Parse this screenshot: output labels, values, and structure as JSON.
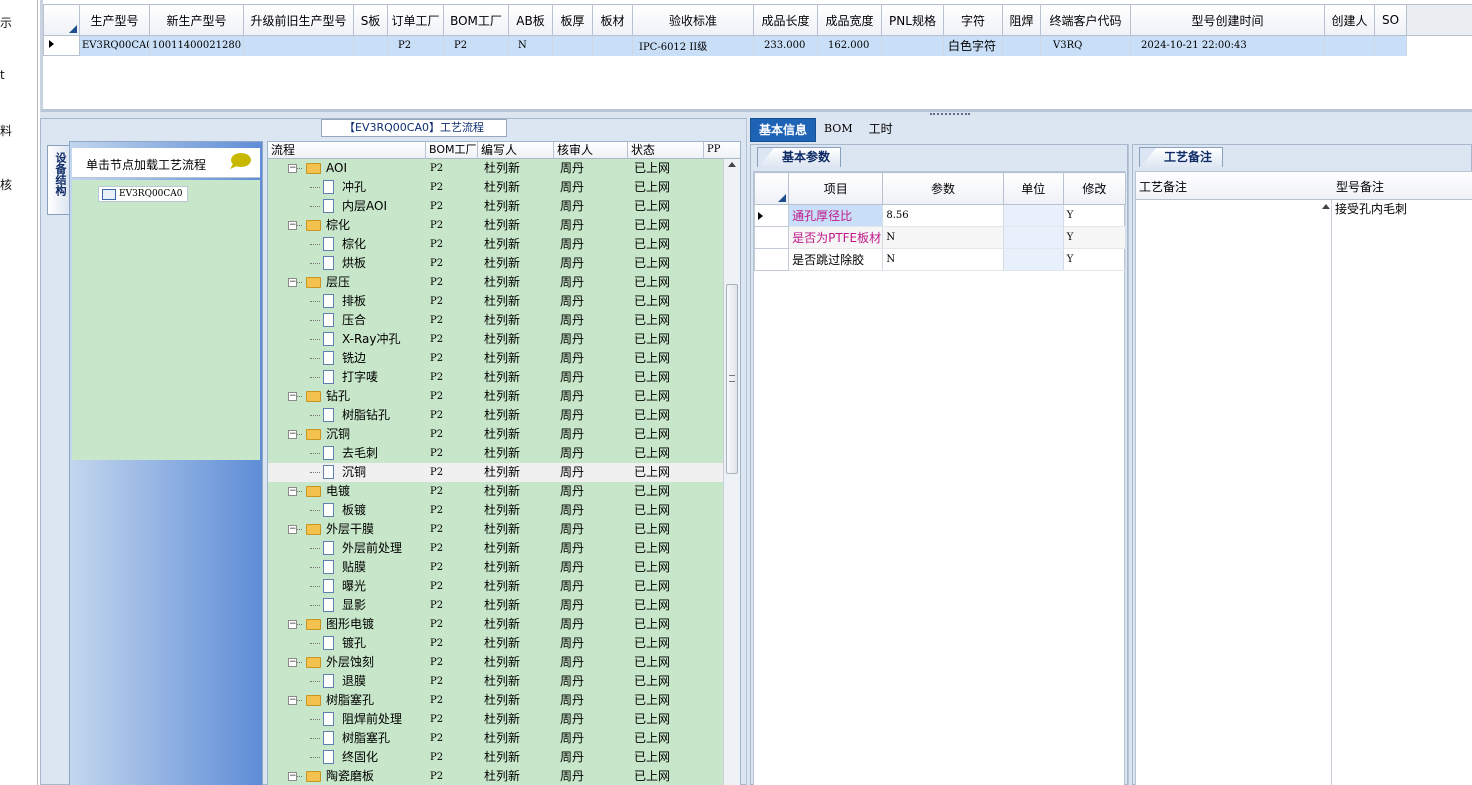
{
  "left_strip": {
    "items": [
      "示",
      "t",
      "料",
      "核"
    ]
  },
  "top_grid": {
    "headers": [
      "生产型号",
      "新生产型号",
      "升级前旧生产型号",
      "S板",
      "订单工厂",
      "BOM工厂",
      "AB板",
      "板厚",
      "板材",
      "验收标准",
      "成品长度",
      "成品宽度",
      "PNL规格",
      "字符",
      "阻焊",
      "终端客户代码",
      "型号创建时间",
      "创建人",
      "SO"
    ],
    "row": [
      "EV3RQ00CA0",
      "10011400021280",
      "",
      "",
      "P2",
      "P2",
      "N",
      "",
      "",
      "IPC-6012 II级",
      "233.000",
      "162.000",
      "",
      "白色字符",
      "",
      "V3RQ",
      "2024-10-21 22:00:43",
      "",
      ""
    ]
  },
  "process_panel": {
    "title": "【EV3RQ00CA0】工艺流程",
    "vertical_tab": "设备结构",
    "equip_header": "单击节点加载工艺流程",
    "equip_node": "EV3RQ00CA0",
    "tree_headers": [
      "流程",
      "BOM工厂",
      "编写人",
      "核审人",
      "状态",
      "PP"
    ],
    "rows": [
      {
        "name": "AOI",
        "type": "folder",
        "bom": "P2",
        "writer": "杜列新",
        "reviewer": "周丹",
        "status": "已上网"
      },
      {
        "name": "冲孔",
        "type": "leaf",
        "bom": "P2",
        "writer": "杜列新",
        "reviewer": "周丹",
        "status": "已上网"
      },
      {
        "name": "内层AOI",
        "type": "leaf",
        "bom": "P2",
        "writer": "杜列新",
        "reviewer": "周丹",
        "status": "已上网"
      },
      {
        "name": "棕化",
        "type": "folder",
        "bom": "P2",
        "writer": "杜列新",
        "reviewer": "周丹",
        "status": "已上网"
      },
      {
        "name": "棕化",
        "type": "leaf",
        "bom": "P2",
        "writer": "杜列新",
        "reviewer": "周丹",
        "status": "已上网"
      },
      {
        "name": "烘板",
        "type": "leaf",
        "bom": "P2",
        "writer": "杜列新",
        "reviewer": "周丹",
        "status": "已上网"
      },
      {
        "name": "层压",
        "type": "folder",
        "bom": "P2",
        "writer": "杜列新",
        "reviewer": "周丹",
        "status": "已上网"
      },
      {
        "name": "排板",
        "type": "leaf",
        "bom": "P2",
        "writer": "杜列新",
        "reviewer": "周丹",
        "status": "已上网"
      },
      {
        "name": "压合",
        "type": "leaf",
        "bom": "P2",
        "writer": "杜列新",
        "reviewer": "周丹",
        "status": "已上网"
      },
      {
        "name": "X-Ray冲孔",
        "type": "leaf",
        "bom": "P2",
        "writer": "杜列新",
        "reviewer": "周丹",
        "status": "已上网"
      },
      {
        "name": "铣边",
        "type": "leaf",
        "bom": "P2",
        "writer": "杜列新",
        "reviewer": "周丹",
        "status": "已上网"
      },
      {
        "name": "打字唛",
        "type": "leaf",
        "bom": "P2",
        "writer": "杜列新",
        "reviewer": "周丹",
        "status": "已上网"
      },
      {
        "name": "钻孔",
        "type": "folder",
        "bom": "P2",
        "writer": "杜列新",
        "reviewer": "周丹",
        "status": "已上网"
      },
      {
        "name": "树脂钻孔",
        "type": "leaf",
        "bom": "P2",
        "writer": "杜列新",
        "reviewer": "周丹",
        "status": "已上网"
      },
      {
        "name": "沉铜",
        "type": "folder",
        "bom": "P2",
        "writer": "杜列新",
        "reviewer": "周丹",
        "status": "已上网"
      },
      {
        "name": "去毛刺",
        "type": "leaf",
        "bom": "P2",
        "writer": "杜列新",
        "reviewer": "周丹",
        "status": "已上网"
      },
      {
        "name": "沉铜",
        "type": "leaf",
        "bom": "P2",
        "writer": "杜列新",
        "reviewer": "周丹",
        "status": "已上网",
        "selected": true
      },
      {
        "name": "电镀",
        "type": "folder",
        "bom": "P2",
        "writer": "杜列新",
        "reviewer": "周丹",
        "status": "已上网"
      },
      {
        "name": "板镀",
        "type": "leaf",
        "bom": "P2",
        "writer": "杜列新",
        "reviewer": "周丹",
        "status": "已上网"
      },
      {
        "name": "外层干膜",
        "type": "folder",
        "bom": "P2",
        "writer": "杜列新",
        "reviewer": "周丹",
        "status": "已上网"
      },
      {
        "name": "外层前处理",
        "type": "leaf",
        "bom": "P2",
        "writer": "杜列新",
        "reviewer": "周丹",
        "status": "已上网"
      },
      {
        "name": "贴膜",
        "type": "leaf",
        "bom": "P2",
        "writer": "杜列新",
        "reviewer": "周丹",
        "status": "已上网"
      },
      {
        "name": "曝光",
        "type": "leaf",
        "bom": "P2",
        "writer": "杜列新",
        "reviewer": "周丹",
        "status": "已上网"
      },
      {
        "name": "显影",
        "type": "leaf",
        "bom": "P2",
        "writer": "杜列新",
        "reviewer": "周丹",
        "status": "已上网"
      },
      {
        "name": "图形电镀",
        "type": "folder",
        "bom": "P2",
        "writer": "杜列新",
        "reviewer": "周丹",
        "status": "已上网"
      },
      {
        "name": "镀孔",
        "type": "leaf",
        "bom": "P2",
        "writer": "杜列新",
        "reviewer": "周丹",
        "status": "已上网"
      },
      {
        "name": "外层蚀刻",
        "type": "folder",
        "bom": "P2",
        "writer": "杜列新",
        "reviewer": "周丹",
        "status": "已上网"
      },
      {
        "name": "退膜",
        "type": "leaf",
        "bom": "P2",
        "writer": "杜列新",
        "reviewer": "周丹",
        "status": "已上网"
      },
      {
        "name": "树脂塞孔",
        "type": "folder",
        "bom": "P2",
        "writer": "杜列新",
        "reviewer": "周丹",
        "status": "已上网"
      },
      {
        "name": "阻焊前处理",
        "type": "leaf",
        "bom": "P2",
        "writer": "杜列新",
        "reviewer": "周丹",
        "status": "已上网"
      },
      {
        "name": "树脂塞孔",
        "type": "leaf",
        "bom": "P2",
        "writer": "杜列新",
        "reviewer": "周丹",
        "status": "已上网"
      },
      {
        "name": "终固化",
        "type": "leaf",
        "bom": "P2",
        "writer": "杜列新",
        "reviewer": "周丹",
        "status": "已上网"
      },
      {
        "name": "陶瓷磨板",
        "type": "folder",
        "bom": "P2",
        "writer": "杜列新",
        "reviewer": "周丹",
        "status": "已上网"
      }
    ]
  },
  "main_tabs": [
    "基本信息",
    "BOM",
    "工时"
  ],
  "params": {
    "tab": "基本参数",
    "headers": [
      "项目",
      "参数",
      "单位",
      "修改"
    ],
    "rows": [
      {
        "item": "通孔厚径比",
        "value": "8.56",
        "unit": "",
        "mod": "Y"
      },
      {
        "item": "是否为PTFE板材",
        "value": "N",
        "unit": "",
        "mod": "Y"
      },
      {
        "item": "是否跳过除胶",
        "value": "N",
        "unit": "",
        "mod": "Y"
      }
    ]
  },
  "notes": {
    "tab": "工艺备注",
    "col1_header": "工艺备注",
    "col2_header": "型号备注",
    "col2_value": "接受孔内毛刺"
  },
  "colors": {
    "tree_bg": "#c8e6c9",
    "selection_blue": "#c9dff7",
    "active_tab": "#1f63b7",
    "magenta_text": "#c0188a",
    "folder": "#f2c14e"
  }
}
